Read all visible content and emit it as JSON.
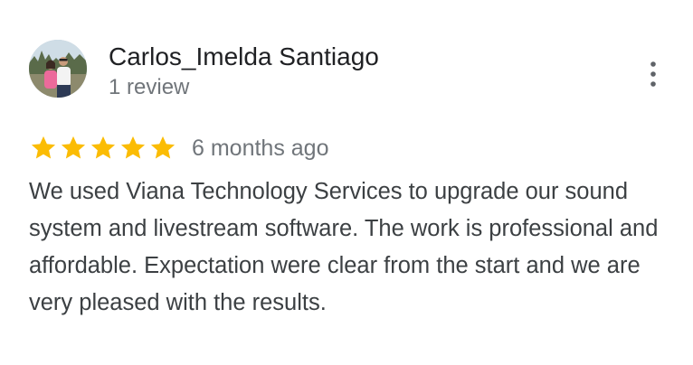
{
  "review": {
    "reviewer_name": "Carlos_Imelda Santiago",
    "review_count": "1 review",
    "rating": 5,
    "max_rating": 5,
    "date": "6 months ago",
    "text": "We used Viana Technology Services to upgrade our sound system and livestream software. The work is professional and affordable. Expectation were clear from the start and we are very pleased with the results."
  },
  "icons": {
    "avatar": "avatar-photo",
    "more": "more-vert-icon",
    "star": "star-icon"
  },
  "colors": {
    "star": "#fbbc04",
    "name": "#202124",
    "secondary": "#70757a",
    "body_text": "#3c4043",
    "more_icon": "#5f6368"
  }
}
